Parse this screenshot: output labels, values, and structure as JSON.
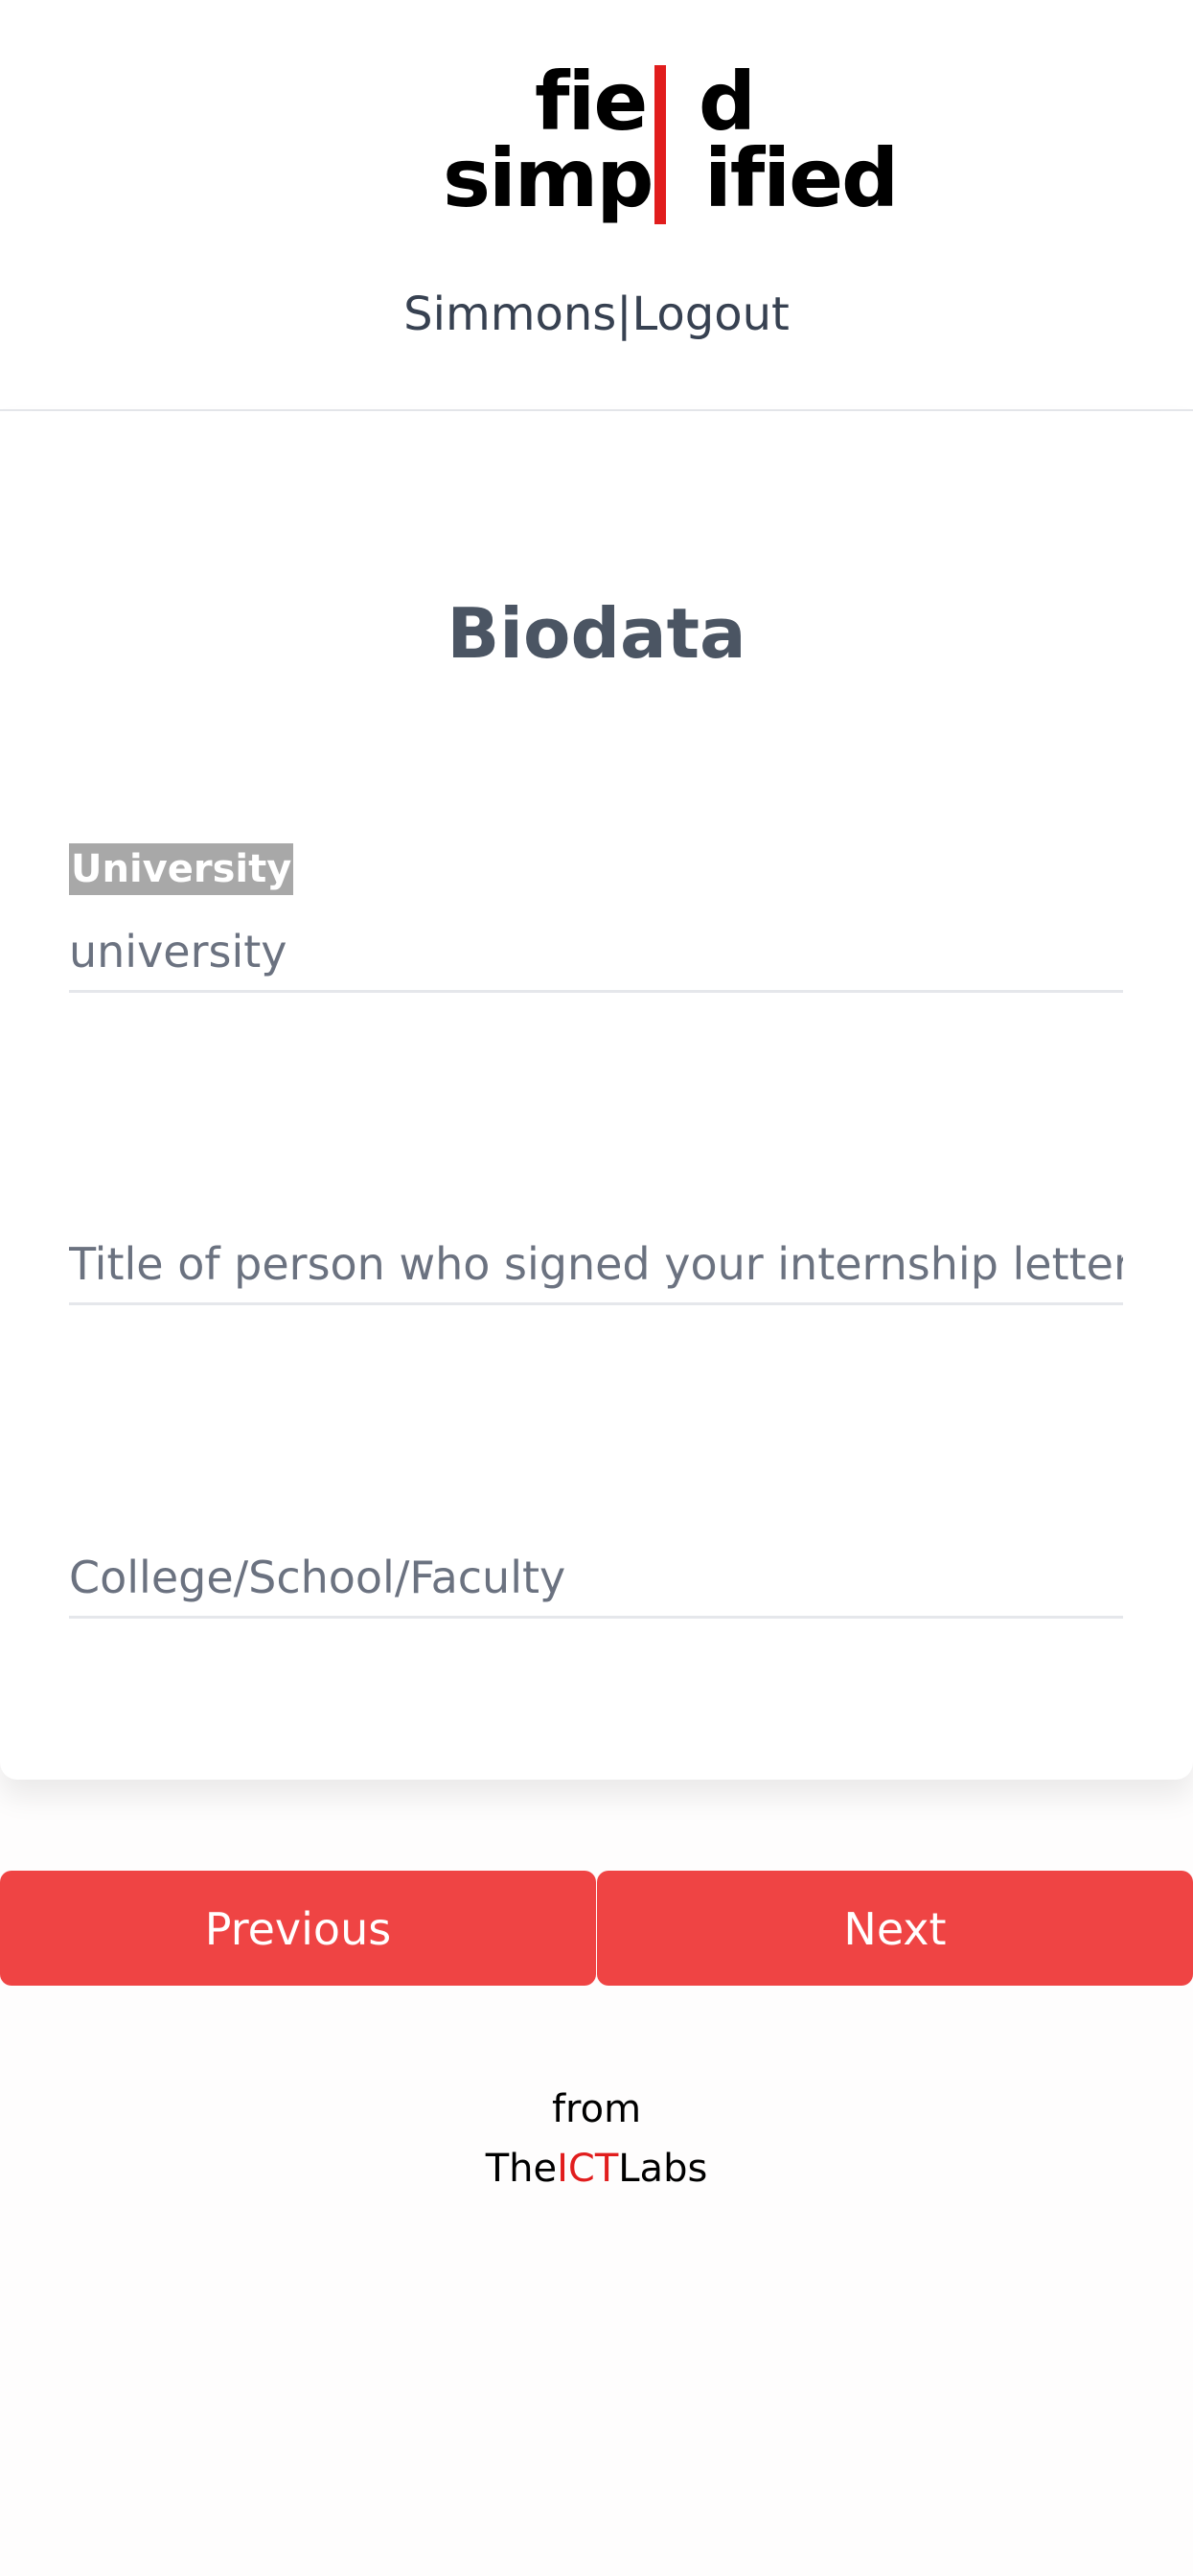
{
  "header": {
    "logo": {
      "line1_left": "fie",
      "line1_right": "d",
      "line2_left": "simp",
      "line2_right": "ified",
      "bar_color": "#e11d1d",
      "alt": "field simplified"
    },
    "user_name": "Simmons",
    "separator": "|",
    "logout_label": "Logout"
  },
  "form": {
    "title": "Biodata",
    "university_label": "University",
    "university_value": "university",
    "university_placeholder": "University",
    "signatory_title_placeholder": "Title of person who signed your internship letter",
    "college_placeholder": "College/School/Faculty"
  },
  "buttons": {
    "previous_label": "Previous",
    "next_label": "Next",
    "color": "#ef4444"
  },
  "footer": {
    "from_text": "from",
    "brand_prefix": "The",
    "brand_accent": "ICT",
    "brand_suffix": "Labs",
    "accent_color": "#e11d1d"
  }
}
